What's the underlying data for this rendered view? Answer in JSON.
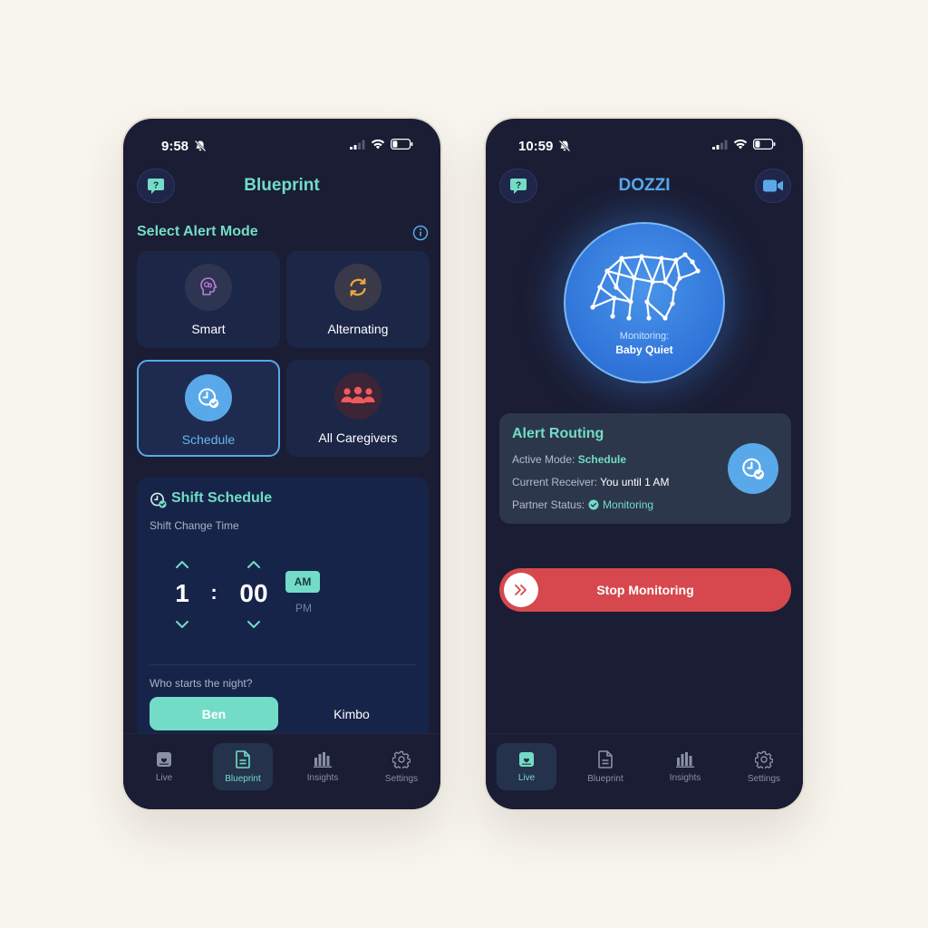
{
  "left": {
    "status": {
      "time": "9:58"
    },
    "header": {
      "title": "Blueprint"
    },
    "section_title": "Select Alert Mode",
    "modes": [
      {
        "label": "Smart",
        "icon": "brain-icon"
      },
      {
        "label": "Alternating",
        "icon": "sync-icon"
      },
      {
        "label": "Schedule",
        "icon": "clock-check-icon",
        "selected": true
      },
      {
        "label": "All Caregivers",
        "icon": "group-icon"
      }
    ],
    "shift": {
      "title": "Shift Schedule",
      "subtitle": "Shift Change Time",
      "hour": "1",
      "separator": ":",
      "minute": "00",
      "am": "AM",
      "pm": "PM",
      "selected_period": "AM",
      "who_label": "Who starts the night?",
      "options": [
        "Ben",
        "Kimbo"
      ],
      "selected_option": "Ben"
    },
    "tabs": [
      {
        "label": "Live"
      },
      {
        "label": "Blueprint"
      },
      {
        "label": "Insights"
      },
      {
        "label": "Settings"
      }
    ],
    "active_tab": "Blueprint"
  },
  "right": {
    "status": {
      "time": "10:59"
    },
    "header": {
      "title": "DOZZI"
    },
    "monitor": {
      "label": "Monitoring:",
      "value": "Baby Quiet"
    },
    "routing": {
      "title": "Alert Routing",
      "active_mode_label": "Active Mode:",
      "active_mode_value": "Schedule",
      "receiver_label": "Current Receiver:",
      "receiver_value": "You until 1 AM",
      "partner_label": "Partner Status:",
      "partner_value": "Monitoring"
    },
    "stop_button": "Stop Monitoring",
    "tabs": [
      {
        "label": "Live"
      },
      {
        "label": "Blueprint"
      },
      {
        "label": "Insights"
      },
      {
        "label": "Settings"
      }
    ],
    "active_tab": "Live"
  },
  "colors": {
    "background": "#f8f5ee",
    "screen": "#1a1d33",
    "accent_teal": "#73dcc7",
    "accent_blue": "#59a9ea",
    "danger_red": "#d6484d",
    "card": "#1c2747"
  }
}
